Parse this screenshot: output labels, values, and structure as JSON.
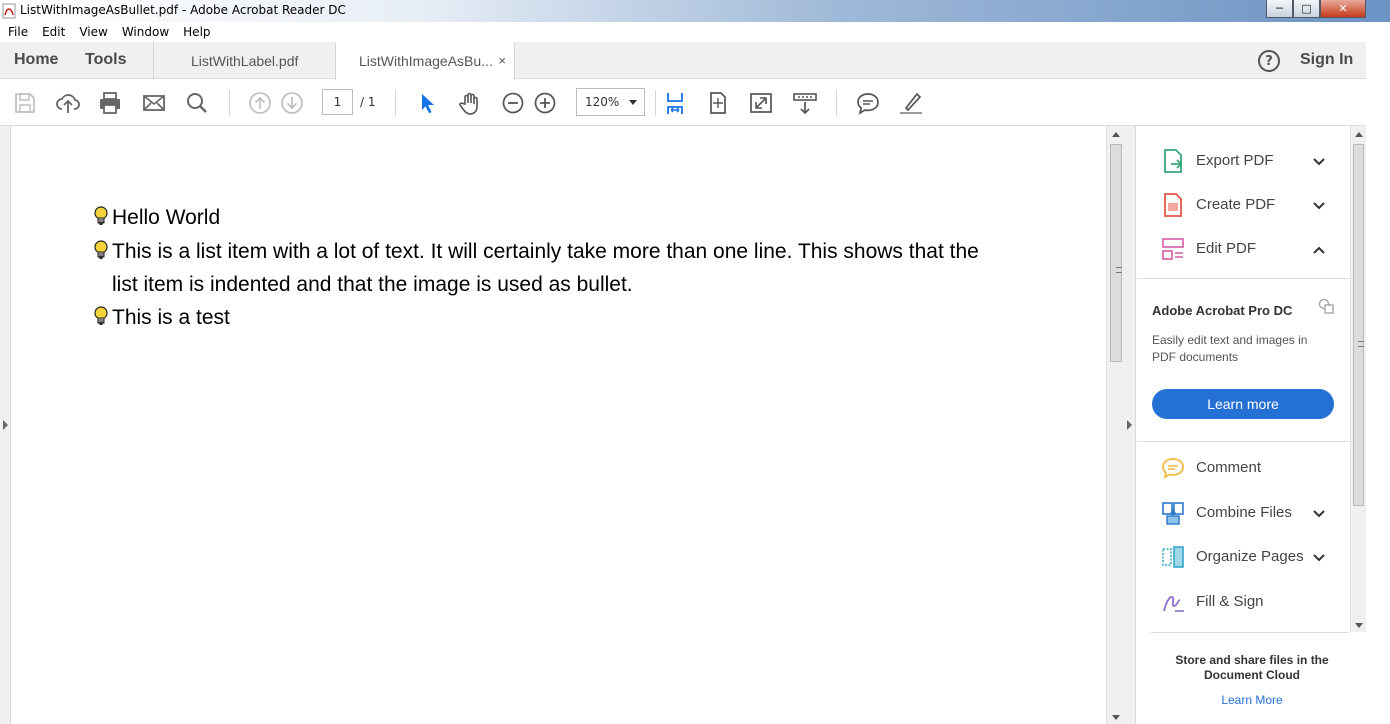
{
  "window": {
    "title": "ListWithImageAsBullet.pdf - Adobe Acrobat Reader DC",
    "minimize": "─",
    "maximize": "□",
    "close": "✕"
  },
  "menu": [
    "File",
    "Edit",
    "View",
    "Window",
    "Help"
  ],
  "tabs": {
    "home": "Home",
    "tools": "Tools",
    "documents": [
      {
        "label": "ListWithLabel.pdf",
        "active": false
      },
      {
        "label": "ListWithImageAsBu...",
        "active": true
      }
    ],
    "close_glyph": "×",
    "help_glyph": "?",
    "sign_in": "Sign In"
  },
  "toolbar": {
    "icons": [
      "save-icon",
      "upload-icon",
      "print-icon",
      "email-icon",
      "search-icon",
      "prev-page-icon",
      "next-page-icon",
      "select-pointer-icon",
      "hand-icon",
      "zoom-out-icon",
      "zoom-in-icon",
      "fit-width-icon",
      "fit-page-icon",
      "full-screen-icon",
      "read-mode-icon",
      "comment-icon",
      "highlight-icon"
    ],
    "page_current": "1",
    "page_total": "/ 1",
    "zoom": "120%"
  },
  "document": {
    "list": [
      {
        "lines": [
          "Hello World"
        ]
      },
      {
        "lines": [
          "This is a list item with a lot of text. It will certainly take more than one line. This shows that the",
          "list item is indented and that the image is used as bullet."
        ]
      },
      {
        "lines": [
          "This is a test"
        ]
      }
    ]
  },
  "right_panel": {
    "tools_top": [
      {
        "label": "Export PDF",
        "icon": "export-pdf-icon",
        "chevron": "down",
        "color": "#3aa67a"
      },
      {
        "label": "Create PDF",
        "icon": "create-pdf-icon",
        "chevron": "down",
        "color": "#e0584a"
      },
      {
        "label": "Edit PDF",
        "icon": "edit-pdf-icon",
        "chevron": "up",
        "color": "#d75ca6"
      }
    ],
    "promo": {
      "title": "Adobe Acrobat Pro DC",
      "description": "Easily edit text and images in PDF documents",
      "button": "Learn more"
    },
    "tools_bottom": [
      {
        "label": "Comment",
        "icon": "comment-tool-icon",
        "chevron": "",
        "color": "#f3b93c"
      },
      {
        "label": "Combine Files",
        "icon": "combine-files-icon",
        "chevron": "down",
        "color": "#2a79c8"
      },
      {
        "label": "Organize Pages",
        "icon": "organize-pages-icon",
        "chevron": "down",
        "color": "#36a9c8"
      },
      {
        "label": "Fill & Sign",
        "icon": "fill-sign-icon",
        "chevron": "",
        "color": "#8d6fd0"
      }
    ],
    "cloud": {
      "text": "Store and share files in the Document Cloud",
      "link": "Learn More"
    }
  },
  "colors": {
    "accent": "#2470d4",
    "toolbar_icon": "#6a6a6a",
    "select_tool": "#1473e6"
  }
}
